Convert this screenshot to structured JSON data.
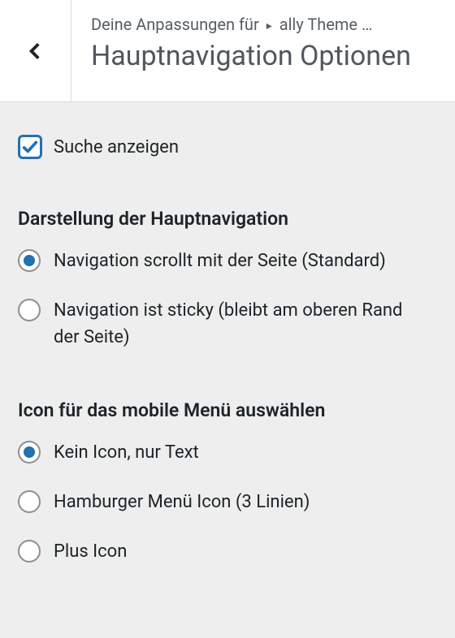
{
  "header": {
    "breadcrumb_prefix": "Deine Anpassungen für",
    "breadcrumb_theme": "ally Theme …",
    "title": "Hauptnavigation Optionen"
  },
  "search": {
    "label": "Suche anzeigen",
    "checked": true
  },
  "sections": {
    "nav_display": {
      "title": "Darstellung der Hauptnavigation",
      "options": [
        {
          "label": "Navigation scrollt mit der Seite (Standard)",
          "checked": true
        },
        {
          "label": "Navigation ist sticky (bleibt am oberen Rand der Seite)",
          "checked": false
        }
      ]
    },
    "mobile_icon": {
      "title": "Icon für das mobile Menü auswählen",
      "options": [
        {
          "label": "Kein Icon, nur Text",
          "checked": true
        },
        {
          "label": "Hamburger Menü Icon (3 Linien)",
          "checked": false
        },
        {
          "label": "Plus Icon",
          "checked": false
        }
      ]
    }
  }
}
